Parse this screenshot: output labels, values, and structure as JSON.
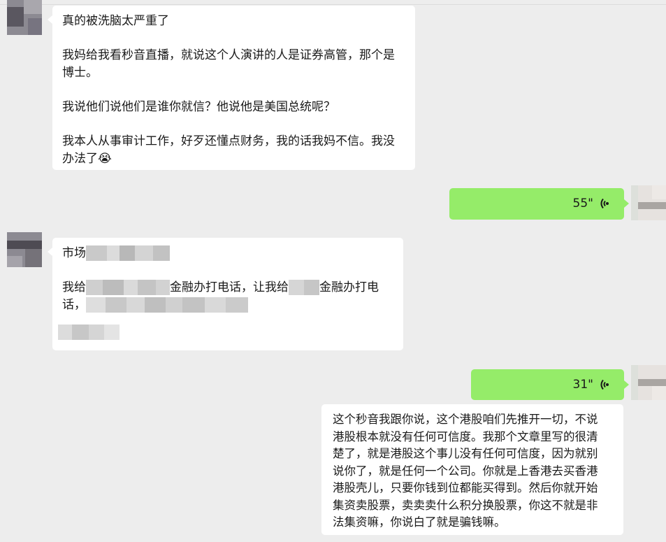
{
  "messages": [
    {
      "id": "m1",
      "sender": "contact",
      "paragraphs": [
        "真的被洗脑太严重了",
        "我妈给我看秒音直播，就说这个人演讲的人是证券高管，那个是博士。",
        "我说他们说他们是谁你就信？他说他是美国总统呢？",
        "我本人从事审计工作，好歹还懂点财务，我的话我妈不信。我没办法了"
      ],
      "emoji": "😭"
    },
    {
      "id": "m2",
      "sender": "me",
      "type": "voice",
      "duration": "55\""
    },
    {
      "id": "m3",
      "sender": "contact",
      "line1_prefix": "市场",
      "line2_prefix": "我给",
      "line2_mid": "金融办打电话，让我给",
      "line2_suffix": "金融办打电",
      "line3_prefix": "话，"
    },
    {
      "id": "m4",
      "sender": "me",
      "type": "voice",
      "duration": "31\""
    },
    {
      "id": "m5",
      "sender": "me",
      "lines": [
        "这个秒音我跟你说，这个港股咱们先推开一切，不说",
        "港股根本就没有任何可信度。我那个文章里写的很清",
        "楚了，就是港股这个事儿没有任何可信度，因为就别",
        "说你了，就是任何一个公司。你就是上香港去买香港",
        "港股壳儿，只要你钱到位都能买得到。然后你就开始",
        "集资卖股票，卖卖卖什么积分换股票，你这不就是非",
        "法集资嘛，你说白了就是骗钱嘛。"
      ]
    }
  ],
  "colors": {
    "background": "#ededed",
    "incoming": "#ffffff",
    "outgoing": "#95ec69"
  },
  "icons": {
    "voice": "voice-wave-icon",
    "emoji": "crying-face-emoji"
  }
}
